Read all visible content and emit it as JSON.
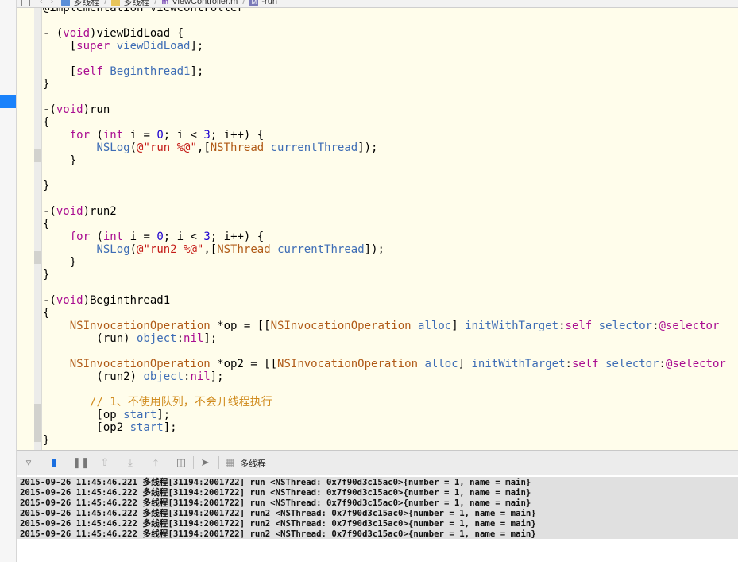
{
  "jumpbar": {
    "project": "多线程",
    "group": "多线程",
    "file_prefix": "m",
    "file": "ViewController.m",
    "symbol_prefix": "M",
    "symbol": "-run"
  },
  "editor": {
    "lines": [
      [
        [
          "plain",
          "@implementation ViewController"
        ]
      ],
      [],
      [
        [
          "plain",
          "- ("
        ],
        [
          "kw",
          "void"
        ],
        [
          "plain",
          ")viewDidLoad {"
        ]
      ],
      [
        [
          "plain",
          "    ["
        ],
        [
          "kw",
          "super"
        ],
        [
          "plain",
          " "
        ],
        [
          "m",
          "viewDidLoad"
        ],
        [
          "plain",
          "];"
        ]
      ],
      [],
      [
        [
          "plain",
          "    ["
        ],
        [
          "kw",
          "self"
        ],
        [
          "plain",
          " "
        ],
        [
          "m",
          "Beginthread1"
        ],
        [
          "plain",
          "];"
        ]
      ],
      [
        [
          "plain",
          "}"
        ]
      ],
      [],
      [
        [
          "plain",
          "-("
        ],
        [
          "kw",
          "void"
        ],
        [
          "plain",
          ")run"
        ]
      ],
      [
        [
          "plain",
          "{"
        ]
      ],
      [
        [
          "plain",
          "    "
        ],
        [
          "kw",
          "for"
        ],
        [
          "plain",
          " ("
        ],
        [
          "kw",
          "int"
        ],
        [
          "plain",
          " i = "
        ],
        [
          "num",
          "0"
        ],
        [
          "plain",
          "; i < "
        ],
        [
          "num",
          "3"
        ],
        [
          "plain",
          "; i++) {"
        ]
      ],
      [
        [
          "plain",
          "        "
        ],
        [
          "m",
          "NSLog"
        ],
        [
          "plain",
          "("
        ],
        [
          "str",
          "@\"run %@\""
        ],
        [
          "plain",
          ",["
        ],
        [
          "cls",
          "NSThread"
        ],
        [
          "plain",
          " "
        ],
        [
          "m",
          "currentThread"
        ],
        [
          "plain",
          "]);"
        ]
      ],
      [
        [
          "plain",
          "    }"
        ]
      ],
      [],
      [
        [
          "plain",
          "}"
        ]
      ],
      [],
      [
        [
          "plain",
          "-("
        ],
        [
          "kw",
          "void"
        ],
        [
          "plain",
          ")run2"
        ]
      ],
      [
        [
          "plain",
          "{"
        ]
      ],
      [
        [
          "plain",
          "    "
        ],
        [
          "kw",
          "for"
        ],
        [
          "plain",
          " ("
        ],
        [
          "kw",
          "int"
        ],
        [
          "plain",
          " i = "
        ],
        [
          "num",
          "0"
        ],
        [
          "plain",
          "; i < "
        ],
        [
          "num",
          "3"
        ],
        [
          "plain",
          "; i++) {"
        ]
      ],
      [
        [
          "plain",
          "        "
        ],
        [
          "m",
          "NSLog"
        ],
        [
          "plain",
          "("
        ],
        [
          "str",
          "@\"run2 %@\""
        ],
        [
          "plain",
          ",["
        ],
        [
          "cls",
          "NSThread"
        ],
        [
          "plain",
          " "
        ],
        [
          "m",
          "currentThread"
        ],
        [
          "plain",
          "]);"
        ]
      ],
      [
        [
          "plain",
          "    }"
        ]
      ],
      [
        [
          "plain",
          "}"
        ]
      ],
      [],
      [
        [
          "plain",
          "-("
        ],
        [
          "kw",
          "void"
        ],
        [
          "plain",
          ")Beginthread1"
        ]
      ],
      [
        [
          "plain",
          "{"
        ]
      ],
      [
        [
          "plain",
          "    "
        ],
        [
          "cls",
          "NSInvocationOperation"
        ],
        [
          "plain",
          " *op = [["
        ],
        [
          "cls",
          "NSInvocationOperation"
        ],
        [
          "plain",
          " "
        ],
        [
          "m",
          "alloc"
        ],
        [
          "plain",
          "] "
        ],
        [
          "m",
          "initWithTarget"
        ],
        [
          "plain",
          ":"
        ],
        [
          "kw",
          "self"
        ],
        [
          "plain",
          " "
        ],
        [
          "m",
          "selector"
        ],
        [
          "plain",
          ":"
        ],
        [
          "kw",
          "@selector"
        ]
      ],
      [
        [
          "plain",
          "        (run) "
        ],
        [
          "m",
          "object"
        ],
        [
          "plain",
          ":"
        ],
        [
          "kw",
          "nil"
        ],
        [
          "plain",
          "];"
        ]
      ],
      [],
      [
        [
          "plain",
          "    "
        ],
        [
          "cls",
          "NSInvocationOperation"
        ],
        [
          "plain",
          " *op2 = [["
        ],
        [
          "cls",
          "NSInvocationOperation"
        ],
        [
          "plain",
          " "
        ],
        [
          "m",
          "alloc"
        ],
        [
          "plain",
          "] "
        ],
        [
          "m",
          "initWithTarget"
        ],
        [
          "plain",
          ":"
        ],
        [
          "kw",
          "self"
        ],
        [
          "plain",
          " "
        ],
        [
          "m",
          "selector"
        ],
        [
          "plain",
          ":"
        ],
        [
          "kw",
          "@selector"
        ]
      ],
      [
        [
          "plain",
          "        (run2) "
        ],
        [
          "m",
          "object"
        ],
        [
          "plain",
          ":"
        ],
        [
          "kw",
          "nil"
        ],
        [
          "plain",
          "];"
        ]
      ],
      [],
      [
        [
          "plain",
          "       "
        ],
        [
          "cmt",
          "// 1、不使用队列，不会开线程执行"
        ]
      ],
      [
        [
          "plain",
          "        [op "
        ],
        [
          "m",
          "start"
        ],
        [
          "plain",
          "];"
        ]
      ],
      [
        [
          "plain",
          "        [op2 "
        ],
        [
          "m",
          "start"
        ],
        [
          "plain",
          "];"
        ]
      ],
      [
        [
          "plain",
          "}"
        ]
      ]
    ]
  },
  "debugbar": {
    "target_label": "多线程"
  },
  "console": {
    "lines": [
      "2015-09-26 11:45:46.221 多线程[31194:2001722] run <NSThread: 0x7f90d3c15ac0>{number = 1, name = main}",
      "2015-09-26 11:45:46.222 多线程[31194:2001722] run <NSThread: 0x7f90d3c15ac0>{number = 1, name = main}",
      "2015-09-26 11:45:46.222 多线程[31194:2001722] run <NSThread: 0x7f90d3c15ac0>{number = 1, name = main}",
      "2015-09-26 11:45:46.222 多线程[31194:2001722] run2 <NSThread: 0x7f90d3c15ac0>{number = 1, name = main}",
      "2015-09-26 11:45:46.222 多线程[31194:2001722] run2 <NSThread: 0x7f90d3c15ac0>{number = 1, name = main}",
      "2015-09-26 11:45:46.222 多线程[31194:2001722] run2 <NSThread: 0x7f90d3c15ac0>{number = 1, name = main}"
    ]
  }
}
